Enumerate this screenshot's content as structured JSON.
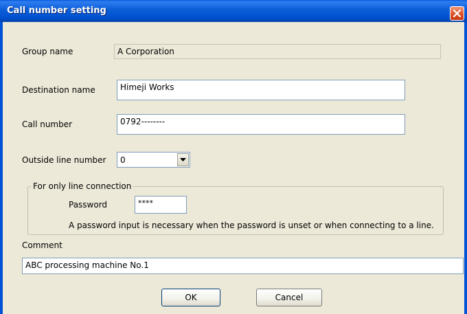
{
  "window": {
    "title": "Call number setting"
  },
  "group_name": {
    "label": "Group name",
    "value": "A Corporation"
  },
  "destination_name": {
    "label": "Destination name",
    "value": "Himeji Works"
  },
  "call_number": {
    "label": "Call number",
    "value": "0792--------"
  },
  "outside_line": {
    "label": "Outside line number",
    "value": "0"
  },
  "line_connection": {
    "legend": "For only line connection",
    "password_label": "Password",
    "password_value": "****",
    "note": "A password input is necessary when the password is unset or when connecting to a line."
  },
  "comment": {
    "label": "Comment",
    "value": "ABC processing machine No.1"
  },
  "buttons": {
    "ok": "OK",
    "cancel": "Cancel"
  },
  "icons": {
    "close": "close-icon",
    "dropdown": "chevron-down-icon"
  },
  "colors": {
    "titlebar": "#0a5bdc",
    "close": "#e05a32",
    "dialog": "#ece9d8"
  }
}
